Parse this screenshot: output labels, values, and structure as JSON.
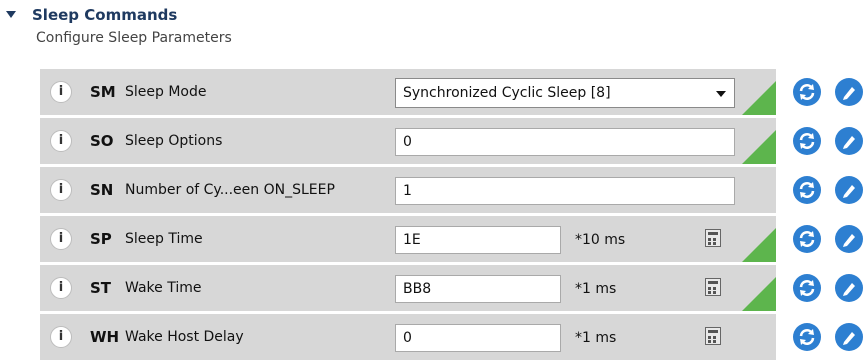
{
  "section": {
    "title": "Sleep Commands",
    "subtitle": "Configure Sleep Parameters"
  },
  "rows": [
    {
      "code": "SM",
      "label": "Sleep Mode",
      "value": "Synchronized Cyclic Sleep [8]",
      "unit": "",
      "changed": true
    },
    {
      "code": "SO",
      "label": "Sleep Options",
      "value": "0",
      "unit": "",
      "changed": true
    },
    {
      "code": "SN",
      "label": "Number of Cy...een ON_SLEEP",
      "value": "1",
      "unit": "",
      "changed": false
    },
    {
      "code": "SP",
      "label": "Sleep Time",
      "value": "1E",
      "unit": "*10 ms",
      "changed": true
    },
    {
      "code": "ST",
      "label": "Wake Time",
      "value": "BB8",
      "unit": "*1 ms",
      "changed": true
    },
    {
      "code": "WH",
      "label": "Wake Host Delay",
      "value": "0",
      "unit": "*1 ms",
      "changed": false
    }
  ],
  "icons": {
    "info": "info-icon",
    "read": "refresh-icon",
    "write": "pencil-icon",
    "calculator": "calculator-icon",
    "expand": "caret-down-icon"
  },
  "colors": {
    "section_title": "#1f3a60",
    "row_background": "#d7d7d7",
    "changed_marker": "#5db54d",
    "action_button": "#2d7fd1"
  },
  "glyphs": {
    "info": "i"
  }
}
